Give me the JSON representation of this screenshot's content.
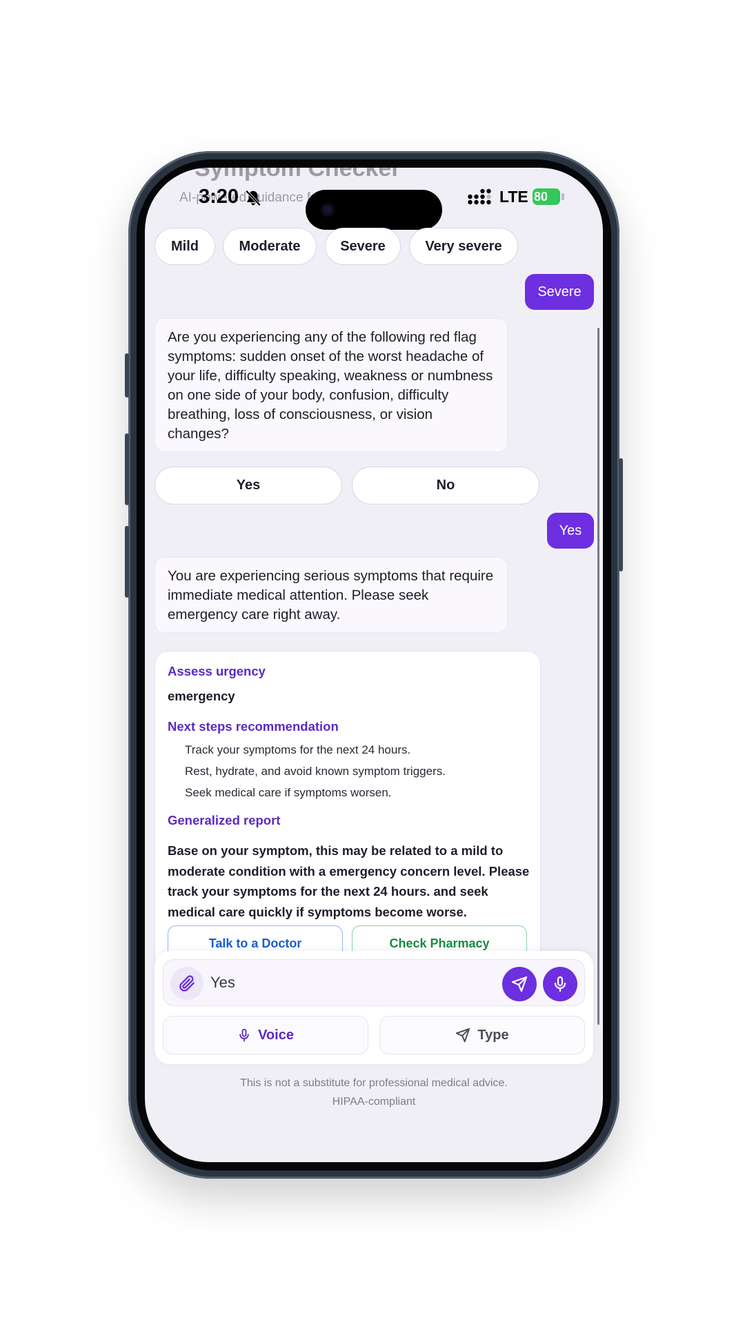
{
  "header": {
    "title": "Symptom Checker",
    "subtitle": "AI-powered guidance for your symptoms"
  },
  "status_bar": {
    "time": "3:20",
    "network": "LTE",
    "battery": "80"
  },
  "severity_chips": [
    "Mild",
    "Moderate",
    "Severe",
    "Very severe"
  ],
  "messages": {
    "user_1": "Severe",
    "bot_1": "Are you experiencing any of the following red flag symptoms: sudden onset of the worst headache of your life, difficulty speaking, weakness or numbness on one side of your body, confusion, difficulty breathing, loss of consciousness, or vision changes?",
    "answer_yes": "Yes",
    "answer_no": "No",
    "user_2": "Yes",
    "bot_2": "You are experiencing serious symptoms that require immediate medical attention. Please seek emergency care right away."
  },
  "summary": {
    "urgency_heading": "Assess urgency",
    "urgency_value": "emergency",
    "next_steps_heading": "Next steps recommendation",
    "next_steps": [
      "Track your symptoms for the next 24 hours.",
      "Rest, hydrate, and avoid known symptom triggers.",
      "Seek medical care if symptoms worsen."
    ],
    "report_heading": "Generalized report",
    "report_text": "Base on your symptom, this may be related to a mild to moderate condition with a emergency concern level. Please track your symptoms for the next 24 hours. and seek medical care quickly if symptoms become worse.",
    "doctor_button": "Talk to a Doctor",
    "pharmacy_button": "Check Pharmacy"
  },
  "composer": {
    "input_value": "Yes",
    "voice_label": "Voice",
    "type_label": "Type"
  },
  "footer": {
    "disclaimer": "This is not a substitute for professional medical advice.",
    "compliance": "HIPAA-compliant"
  },
  "colors": {
    "accent": "#6d2fe0",
    "heading": "#5b2bc2",
    "doctor": "#1d5fd1",
    "pharmacy": "#1a8a44",
    "battery": "#34c759"
  },
  "icons": [
    "bell-slash-icon",
    "signal-icon",
    "paperclip-icon",
    "send-icon",
    "microphone-icon"
  ]
}
